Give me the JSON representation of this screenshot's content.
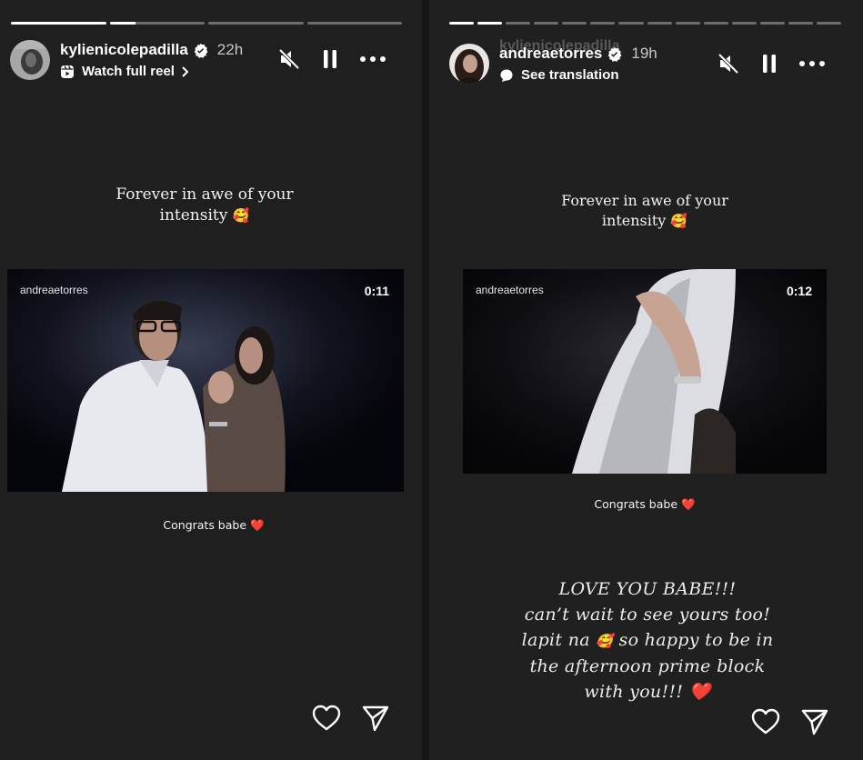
{
  "story1": {
    "progress": [
      1.0,
      0.27,
      0.0,
      0.0
    ],
    "username": "kylienicolepadilla",
    "time": "22h",
    "subline": "Watch full reel",
    "caption_top_line1": "Forever in awe of your",
    "caption_top_line2": "intensity",
    "caption_emoji": "🥰",
    "video": {
      "label": "andreaetorres",
      "time": "0:11"
    },
    "caption_bottom": "Congrats babe",
    "heart_emoji": "❤️"
  },
  "story2": {
    "progress_segments": 14,
    "progress_filled": 1.0,
    "ghost_username": "kylienicolepadilla",
    "username": "andreaetorres",
    "time": "19h",
    "subline": "See translation",
    "caption_top_line1": "Forever in awe of your",
    "caption_top_line2": "intensity",
    "caption_emoji": "🥰",
    "video": {
      "label": "andreaetorres",
      "time": "0:12"
    },
    "caption_bottom": "Congrats babe",
    "heart_emoji": "❤️",
    "love_lines": {
      "l1": "LOVE YOU BABE!!!",
      "l2": "can’t wait to see yours too!",
      "l3a": "lapit na",
      "l3b": "so happy to be in",
      "l4": "the afternoon prime block",
      "l5": "with you!!!"
    }
  },
  "colors": {
    "background": "#1f1f1f",
    "verified": "#ffffff",
    "heart": "#e0283a"
  },
  "icons": [
    "muted-speaker-icon",
    "pause-icon",
    "more-options-icon",
    "heart-icon",
    "send-icon",
    "verified-badge-icon",
    "reel-icon",
    "translate-bubble-icon",
    "chevron-right-icon"
  ]
}
